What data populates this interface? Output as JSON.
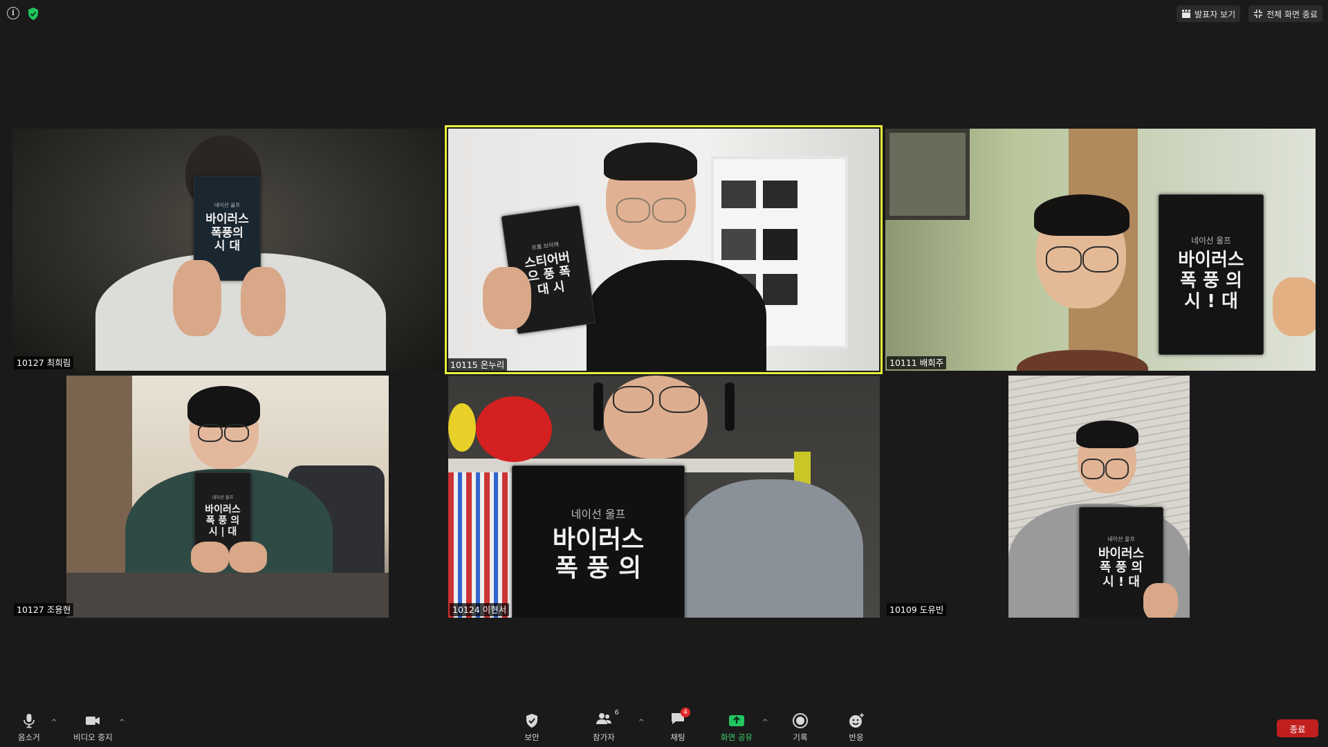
{
  "top_bar": {
    "info_icon": "info-icon",
    "security_icon": "shield-check-icon",
    "speaker_view_label": "발표자 보기",
    "exit_fullscreen_label": "전체 화면 종료"
  },
  "participants": [
    {
      "label": "10127 최희림"
    },
    {
      "label": "10115 온누리"
    },
    {
      "label": "10111 배희주"
    },
    {
      "label": "10127 조용현"
    },
    {
      "label": "10124 이현서"
    },
    {
      "label": "10109 도유빈"
    }
  ],
  "book": {
    "title_line1": "바이러스",
    "title_line2": "폭풍의",
    "title_line3": "시  대",
    "author": "네이선 울프"
  },
  "toolbar": {
    "mute_label": "음소거",
    "video_label": "비디오 중지",
    "security_label": "보안",
    "participants_label": "참가자",
    "participants_count": "6",
    "chat_label": "채팅",
    "chat_badge": "4",
    "share_label": "화면 공유",
    "record_label": "기록",
    "reactions_label": "반응",
    "end_label": "종료"
  },
  "colors": {
    "active_speaker": "#e8f03b",
    "share_green": "#22c55e",
    "end_red": "#c11f1f"
  }
}
